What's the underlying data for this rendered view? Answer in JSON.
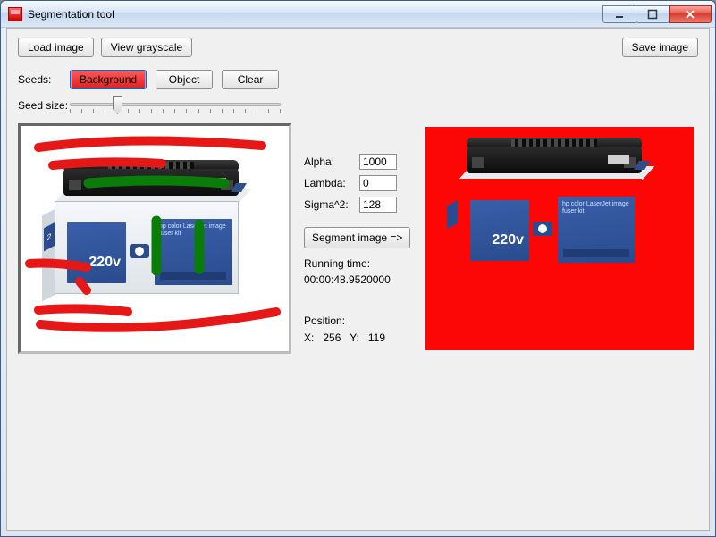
{
  "window": {
    "title": "Segmentation tool"
  },
  "toolbar": {
    "load_image": "Load image",
    "view_grayscale": "View grayscale",
    "save_image": "Save image"
  },
  "seeds": {
    "label": "Seeds:",
    "background": "Background",
    "object": "Object",
    "clear": "Clear"
  },
  "seed_size": {
    "label": "Seed size:"
  },
  "params": {
    "alpha_label": "Alpha:",
    "alpha_value": "1000",
    "lambda_label": "Lambda:",
    "lambda_value": "0",
    "sigma_label": "Sigma^2:",
    "sigma_value": "128"
  },
  "segment_button": "Segment image =>",
  "running": {
    "label": "Running time:",
    "value": "00:00:48.9520000"
  },
  "position": {
    "label": "Position:",
    "x_label": "X:",
    "x_value": "256",
    "y_label": "Y:",
    "y_value": "119"
  },
  "product": {
    "voltage": "220v",
    "desc": "hp\ncolor LaserJet\nimage fuser kit",
    "side_num": "2"
  },
  "colors": {
    "seg_background": "#fc0606",
    "seed_bg": "#e61717",
    "seed_obj": "#0a7c0a"
  }
}
